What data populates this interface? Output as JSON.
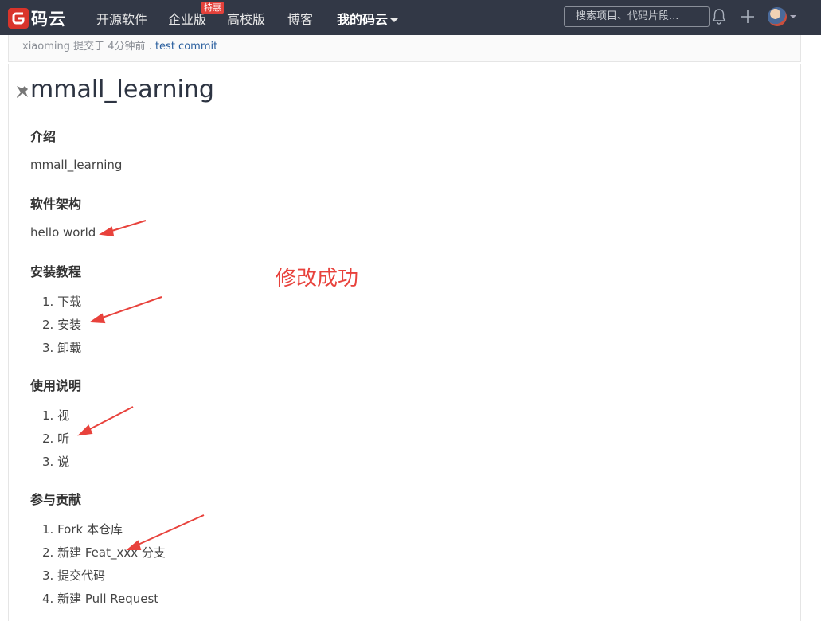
{
  "nav": {
    "logo_text": "码云",
    "items": [
      "开源软件",
      "企业版",
      "高校版",
      "博客",
      "我的码云"
    ],
    "badge": "特惠",
    "search_placeholder": "搜索项目、代码片段..."
  },
  "commit": {
    "author": "xiaoming",
    "action": " 提交于 ",
    "time": "4分钟前",
    "sep": " . ",
    "message": "test commit"
  },
  "readme": {
    "title": "mmall_learning",
    "sections": [
      {
        "heading": "介绍",
        "text": "mmall_learning"
      },
      {
        "heading": "软件架构",
        "text": "hello world"
      },
      {
        "heading": "安装教程",
        "items": [
          "下载",
          "安装",
          "卸载"
        ]
      },
      {
        "heading": "使用说明",
        "items": [
          "视",
          "听",
          "说"
        ]
      },
      {
        "heading": "参与贡献",
        "items": [
          "Fork 本仓库",
          "新建 Feat_xxx 分支",
          "提交代码",
          "新建 Pull Request"
        ]
      }
    ]
  },
  "annotation": "修改成功",
  "colors": {
    "nav_bg": "#323846",
    "brand": "#d9342b",
    "annotation": "#e8423c"
  }
}
